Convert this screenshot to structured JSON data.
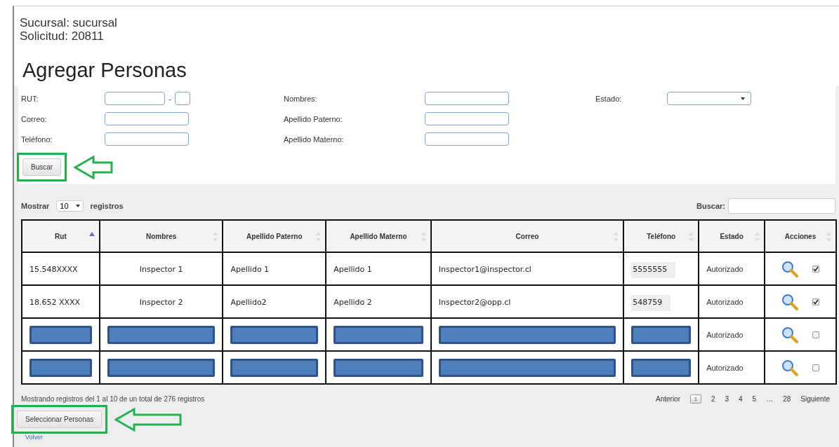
{
  "header": {
    "sucursal": "Sucursal: sucursal",
    "solicitud": "Solicitud: 20811"
  },
  "title": "Agregar Personas",
  "filter_rows": [
    [
      {
        "label": "RUT:",
        "kind": "rut",
        "separator": "-"
      },
      {
        "label": "Nombres:",
        "kind": "text"
      },
      {
        "label": "Estado:",
        "kind": "select"
      }
    ],
    [
      {
        "label": "Correo:",
        "kind": "text"
      },
      {
        "label": "Apellido Paterno:",
        "kind": "text"
      }
    ],
    [
      {
        "label": "Teléfono:",
        "kind": "text"
      },
      {
        "label": "Apellido Materno:",
        "kind": "text"
      }
    ]
  ],
  "search_button": {
    "label": "Buscar",
    "highlighted": true
  },
  "length": {
    "before": "Mostrar",
    "value": "10",
    "after": "registros"
  },
  "table_search": {
    "label": "Buscar:"
  },
  "columns": [
    {
      "label": "Rut",
      "sorted": true
    },
    {
      "label": "Nombres",
      "sorted": false
    },
    {
      "label": "Apellido Paterno",
      "sorted": false
    },
    {
      "label": "Apellido Materno",
      "sorted": false
    },
    {
      "label": "Correo",
      "sorted": false
    },
    {
      "label": "Teléfono",
      "sorted": false
    },
    {
      "label": "Estado",
      "sorted": false
    },
    {
      "label": "Acciones",
      "sorted": false
    }
  ],
  "rows": [
    {
      "redacted": false,
      "cells": [
        "15.548XXXX",
        "Inspector 1",
        "Apellido 1",
        "Apellido 1",
        "Inspector1@inspector.cl",
        "5555555"
      ],
      "estado": "Autorizado",
      "checked": true
    },
    {
      "redacted": false,
      "cells": [
        "18.652 XXXX",
        "Inspector 2",
        "Apellido2",
        "Apellido 2",
        "Inspector2@opp.cl",
        "548759"
      ],
      "estado": "Autorizado",
      "checked": true
    },
    {
      "redacted": true,
      "estado": "Autorizado",
      "checked": false
    },
    {
      "redacted": true,
      "estado": "Autorizado",
      "checked": false
    }
  ],
  "info": "Mostrando registros del 1 al 10 de un total de 276 registros",
  "pagination": {
    "previous": "Anterior",
    "pages": [
      {
        "label": "1",
        "selected": true
      },
      {
        "label": "2",
        "selected": false
      },
      {
        "label": "3",
        "selected": false
      },
      {
        "label": "4",
        "selected": false
      },
      {
        "label": "5",
        "selected": false
      },
      {
        "label": "…",
        "selected": false
      },
      {
        "label": "28",
        "selected": false
      }
    ],
    "next": "Siguiente"
  },
  "select_button": {
    "label": "Seleccionar Personas",
    "highlighted": true
  },
  "back_link": "Volver"
}
